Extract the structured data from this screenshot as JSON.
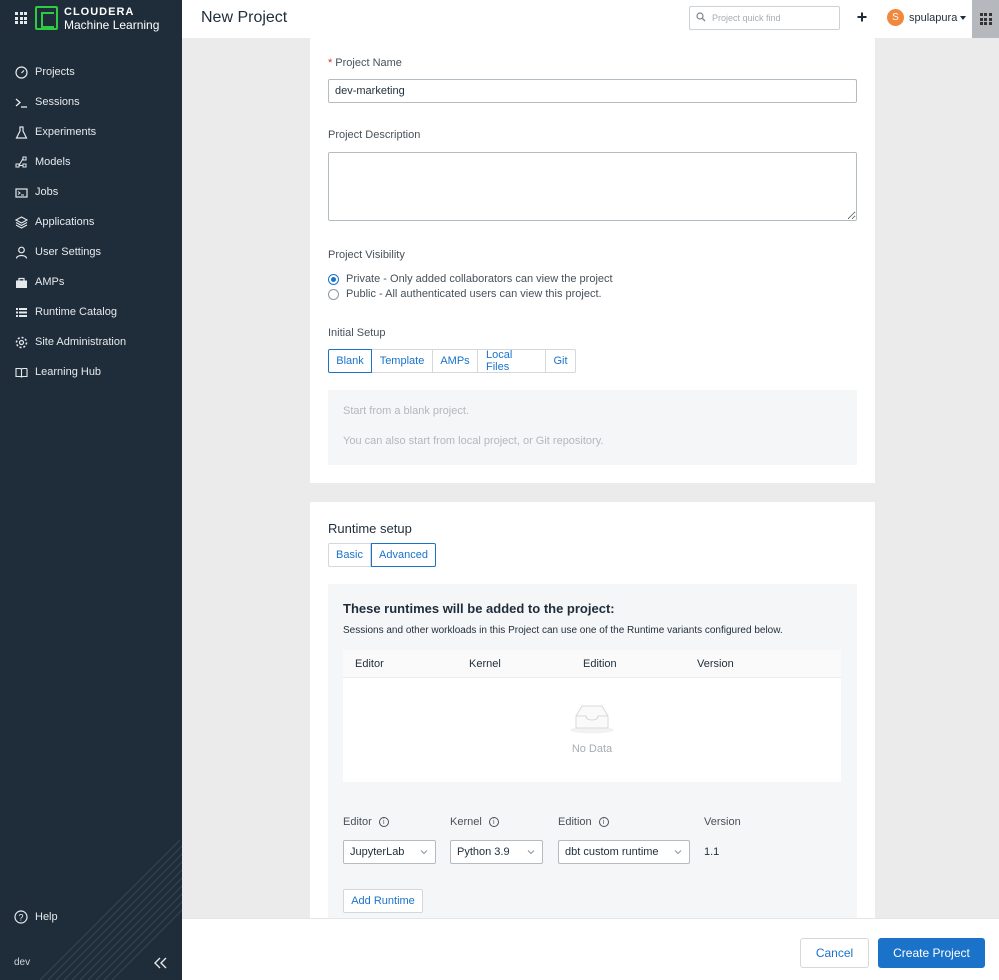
{
  "brand": {
    "line1": "CLOUDERA",
    "line2": "Machine Learning"
  },
  "header": {
    "title": "New Project",
    "search_placeholder": "Project quick find",
    "username": "spulapura",
    "avatar_initial": "S"
  },
  "sidebar": {
    "items": [
      {
        "label": "Projects",
        "icon": "gauge-icon"
      },
      {
        "label": "Sessions",
        "icon": "terminal-icon"
      },
      {
        "label": "Experiments",
        "icon": "flask-icon"
      },
      {
        "label": "Models",
        "icon": "models-icon"
      },
      {
        "label": "Jobs",
        "icon": "jobs-icon"
      },
      {
        "label": "Applications",
        "icon": "layers-icon"
      },
      {
        "label": "User Settings",
        "icon": "user-icon"
      },
      {
        "label": "AMPs",
        "icon": "bag-icon"
      },
      {
        "label": "Runtime Catalog",
        "icon": "list-icon"
      },
      {
        "label": "Site Administration",
        "icon": "gear-icon"
      },
      {
        "label": "Learning Hub",
        "icon": "book-icon"
      }
    ],
    "help_label": "Help",
    "env_label": "dev"
  },
  "form": {
    "name_required_mark": "*",
    "name_label": "Project Name",
    "name_value": "dev-marketing",
    "description_label": "Project Description",
    "visibility_label": "Project Visibility",
    "visibility_options": [
      {
        "label": "Private - Only added collaborators can view the project",
        "checked": true
      },
      {
        "label": "Public - All authenticated users can view this project.",
        "checked": false
      }
    ],
    "initial_setup_label": "Initial Setup",
    "setup_tabs": [
      "Blank",
      "Template",
      "AMPs",
      "Local Files",
      "Git"
    ],
    "setup_active": "Blank",
    "blank_hint1": "Start from a blank project.",
    "blank_hint2": "You can also start from local project, or Git repository."
  },
  "runtime": {
    "title": "Runtime setup",
    "tabs": [
      "Basic",
      "Advanced"
    ],
    "active_tab": "Advanced",
    "added_title": "These runtimes will be added to the project:",
    "added_desc": "Sessions and other workloads in this Project can use one of the Runtime variants configured below.",
    "table_headers": [
      "Editor",
      "Kernel",
      "Edition",
      "Version"
    ],
    "empty_text": "No Data",
    "editor_label": "Editor",
    "kernel_label": "Kernel",
    "edition_label": "Edition",
    "version_label": "Version",
    "editor_value": "JupyterLab",
    "kernel_value": "Python 3.9",
    "edition_value": "dbt custom runtime",
    "version_value": "1.1",
    "add_button": "Add Runtime"
  },
  "footer": {
    "cancel": "Cancel",
    "create": "Create Project"
  },
  "colors": {
    "sidebar": "#1f2d3a",
    "accent": "#1a73c9",
    "brand_green": "#2ecc40",
    "avatar": "#f0883e"
  }
}
